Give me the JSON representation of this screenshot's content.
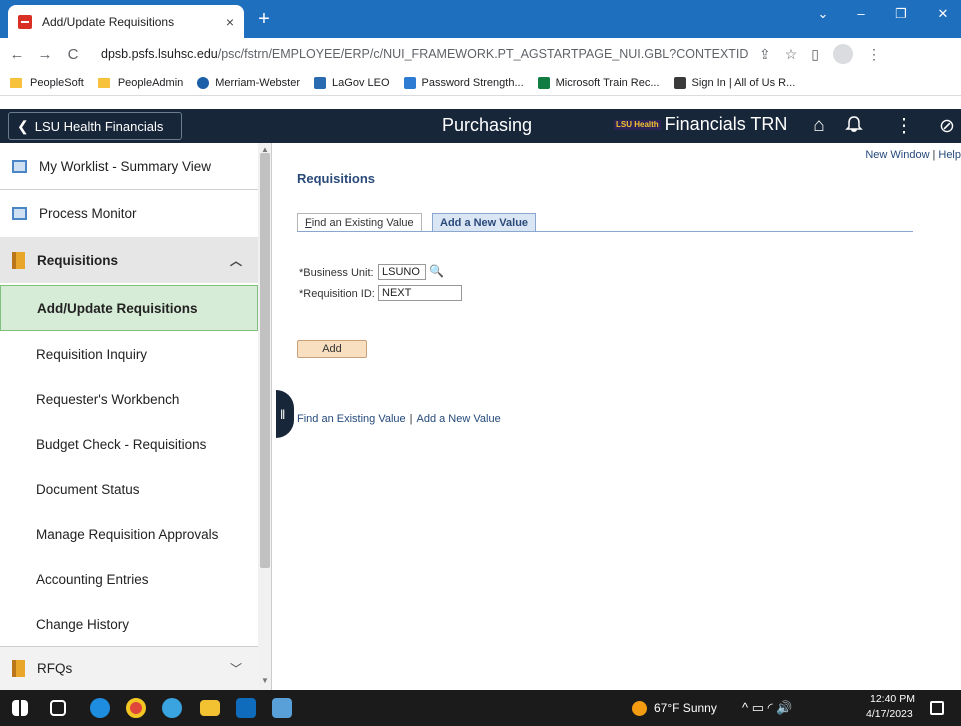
{
  "browser": {
    "tab_title": "Add/Update Requisitions",
    "tab_close": "×",
    "new_tab": "+",
    "window_controls": [
      "⌄",
      "–",
      "❐",
      "✕"
    ],
    "url_host": "dpsb.psfs.lsuhsc.edu",
    "url_path": "/psc/fstrn/EMPLOYEE/ERP/c/NUI_FRAMEWORK.PT_AGSTARTPAGE_NUI.GBL?CONTEXTIDPAR...",
    "nav": {
      "back": "←",
      "forward": "→",
      "reload": "C"
    },
    "addr_icons": [
      "⇪",
      "☆",
      "▯",
      "⋮"
    ],
    "bookmarks": [
      {
        "label": "PeopleSoft",
        "type": "folder"
      },
      {
        "label": "PeopleAdmin",
        "type": "folder"
      },
      {
        "label": "Merriam-Webster",
        "type": "site",
        "color": "#1b5fa8"
      },
      {
        "label": "LaGov LEO",
        "type": "site",
        "color": "#2a6bb0"
      },
      {
        "label": "Password Strength...",
        "type": "site",
        "color": "#2e7bd3"
      },
      {
        "label": "Microsoft Train Rec...",
        "type": "site",
        "color": "#107c41"
      },
      {
        "label": "Sign In | All of Us R...",
        "type": "site",
        "color": "#3a3a3a"
      }
    ]
  },
  "header": {
    "back_label": "LSU Health Financials",
    "back_chevron": "❮",
    "title": "Purchasing",
    "brand_logo": "LSU Health",
    "brand_text": "Financials TRN",
    "icons": {
      "home": "⌂",
      "notifications": "🔔",
      "actions": "⋮",
      "nav": "⊘"
    }
  },
  "sidebar": {
    "items": [
      {
        "label": "My Worklist - Summary View"
      },
      {
        "label": "Process Monitor"
      },
      {
        "label": "Requisitions",
        "caret": "︿"
      },
      {
        "label": "Add/Update Requisitions"
      },
      {
        "label": "Requisition Inquiry"
      },
      {
        "label": "Requester's Workbench"
      },
      {
        "label": "Budget Check - Requisitions"
      },
      {
        "label": "Document Status"
      },
      {
        "label": "Manage Requisition Approvals"
      },
      {
        "label": "Accounting Entries"
      },
      {
        "label": "Change History"
      },
      {
        "label": "RFQs",
        "caret": "﹀"
      }
    ],
    "scroll_up": "▲",
    "scroll_down": "▼"
  },
  "handle_glyph": "‖",
  "content": {
    "new_window": "New Window",
    "help": "Help",
    "link_sep": "|",
    "page_title": "Requisitions",
    "tabs": {
      "find_key": "F",
      "find_rest": "ind an Existing Value",
      "add": "Add a New Value"
    },
    "business_unit_label": "*Business Unit:",
    "business_unit_value": "LSUNO",
    "lookup_icon": "🔍",
    "requisition_id_label": "*Requisition ID:",
    "requisition_id_value": "NEXT",
    "add_button": "Add",
    "bottom_find": "Find an Existing Value",
    "bottom_add": "Add a New Value"
  },
  "taskbar": {
    "weather": "67°F Sunny",
    "time": "12:40 PM",
    "date": "4/17/2023",
    "tray": "^ ▭ ◜ 🔊"
  }
}
